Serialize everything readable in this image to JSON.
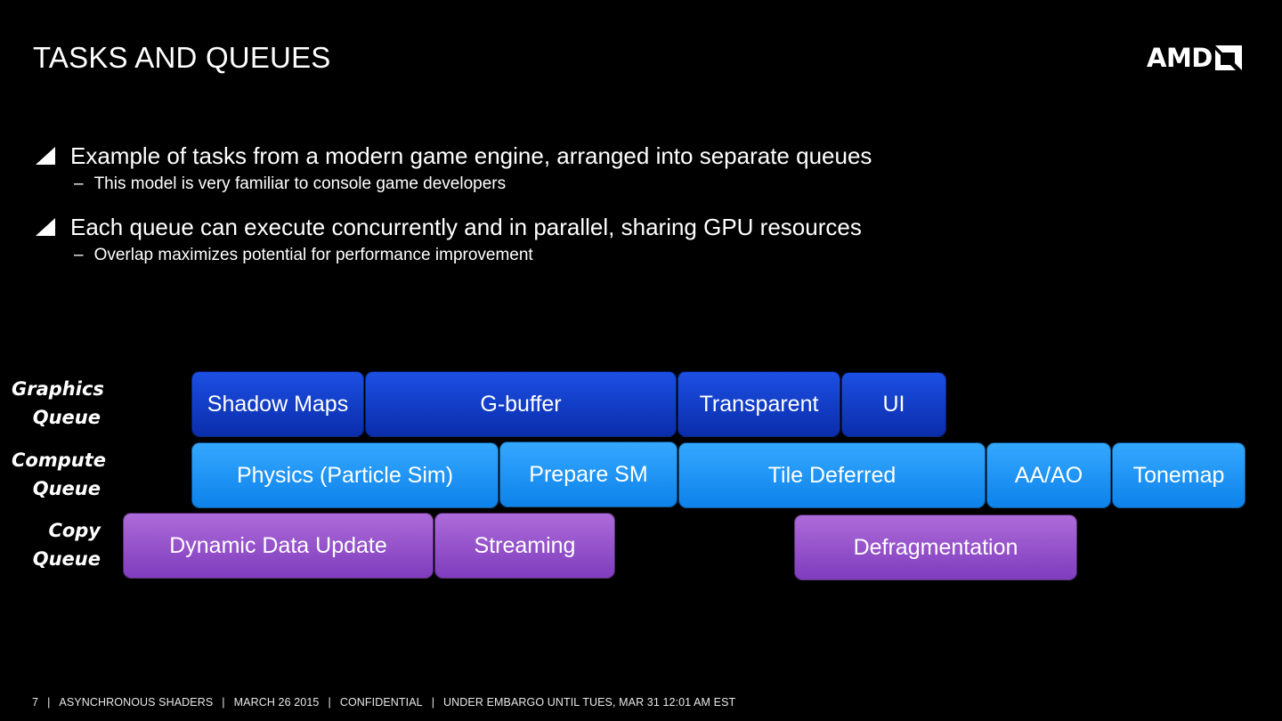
{
  "slide": {
    "title": "TASKS AND QUEUES",
    "logo": {
      "text": "AMD",
      "icon": "amd-arrow-icon"
    }
  },
  "bullets": [
    {
      "icon": "triangle-bullet-icon",
      "text": "Example of tasks from a modern game engine, arranged into separate queues",
      "sub": "This model is very familiar to console game developers"
    },
    {
      "icon": "triangle-bullet-icon",
      "text": "Each queue can execute concurrently and in parallel, sharing GPU resources",
      "sub": "Overlap maximizes potential for performance improvement"
    }
  ],
  "sub_marker": "–",
  "queues": {
    "graphics": {
      "label_line1": "Graphics",
      "label_line2": "Queue",
      "color": "#1a48dc",
      "tasks": [
        "Shadow Maps",
        "G-buffer",
        "Transparent",
        "UI"
      ]
    },
    "compute": {
      "label_line1": "Compute",
      "label_line2": "Queue",
      "color": "#2aa0fb",
      "tasks": [
        "Physics (Particle Sim)",
        "Prepare SM",
        "Tile Deferred",
        "AA/AO",
        "Tonemap"
      ]
    },
    "copy": {
      "label_line1": "Copy",
      "label_line2": "Queue",
      "color": "#9a55cf",
      "tasks": [
        "Dynamic Data Update",
        "Streaming",
        "Defragmentation"
      ]
    }
  },
  "footer": {
    "page": "7",
    "separator": "|",
    "items": [
      "ASYNCHRONOUS SHADERS",
      "MARCH 26 2015",
      "CONFIDENTIAL",
      "UNDER EMBARGO UNTIL TUES, MAR 31 12:01 AM EST"
    ]
  }
}
